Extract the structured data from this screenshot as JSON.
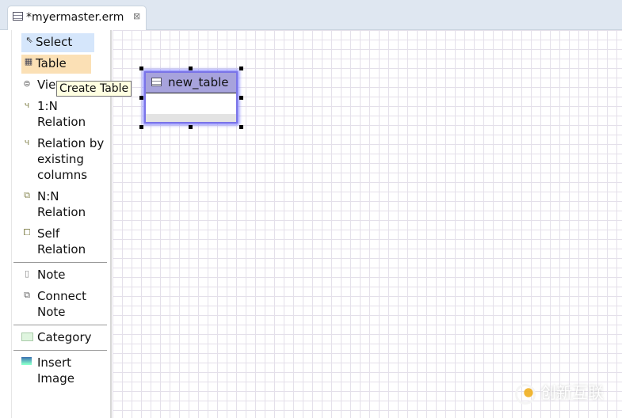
{
  "tab": {
    "title": "*myermaster.erm",
    "close": "⊠"
  },
  "palette": {
    "items": [
      {
        "label": "Select",
        "icon": "arrow-icon"
      },
      {
        "label": "Table",
        "icon": "table-icon"
      },
      {
        "label": "View",
        "icon": "view-icon"
      },
      {
        "label": "1:N Relation",
        "icon": "relation-icon"
      },
      {
        "label": "Relation by existing columns",
        "icon": "relation-icon"
      },
      {
        "label": "N:N Relation",
        "icon": "nn-relation-icon"
      },
      {
        "label": "Self Relation",
        "icon": "self-relation-icon"
      },
      {
        "label": "Note",
        "icon": "note-icon"
      },
      {
        "label": "Connect Note",
        "icon": "connect-note-icon"
      },
      {
        "label": "Category",
        "icon": "category-icon"
      },
      {
        "label": "Insert Image",
        "icon": "image-icon"
      }
    ]
  },
  "tooltip": "Create Table",
  "canvas": {
    "table_name": "new_table"
  },
  "watermark": "创新互联"
}
